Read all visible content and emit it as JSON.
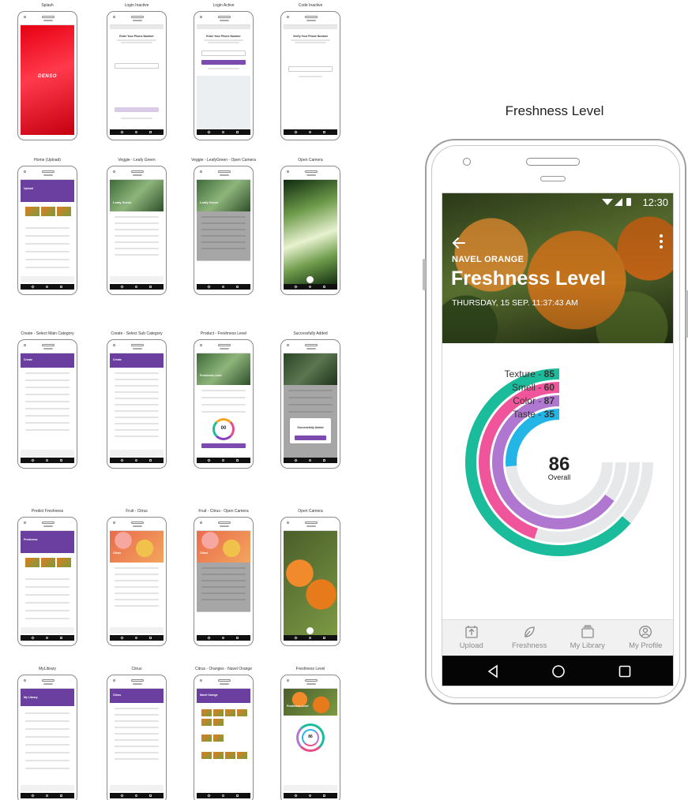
{
  "thumbnails": [
    {
      "caption": "Splash"
    },
    {
      "caption": "Login Inactive"
    },
    {
      "caption": "Login Active"
    },
    {
      "caption": "Code Inactive"
    },
    {
      "caption": "Home (Upload)"
    },
    {
      "caption": "Veggie - Leafy Green"
    },
    {
      "caption": "Veggie - LeafyGreen - Open Camera"
    },
    {
      "caption": "Open Camera"
    },
    {
      "caption": "Create - Select Main Category"
    },
    {
      "caption": "Create - Select Sub Category"
    },
    {
      "caption": "Product - Freshness Level"
    },
    {
      "caption": "Successfully Added"
    },
    {
      "caption": "Predict Freshness"
    },
    {
      "caption": "Fruit - Citrus"
    },
    {
      "caption": "Fruit - Citrus - Open Camera"
    },
    {
      "caption": "Open Camera"
    },
    {
      "caption": "MyLibrary"
    },
    {
      "caption": "Citrus"
    },
    {
      "caption": "Citrus - Oranges - Navel Orange"
    },
    {
      "caption": "Freshness Level"
    }
  ],
  "thumb_text": {
    "splash_logo": "DENSO",
    "enter_phone": "Enter Your Phone Number",
    "verify_phone": "Verify Your Phone Number",
    "upload": "Upload",
    "leafy_green": "Leafy Green",
    "create": "Create",
    "freshness_level": "Freshness Level",
    "successfully_added": "Successfully Added",
    "freshness": "Freshness",
    "citrus": "Citrus",
    "my_library": "My Library",
    "navel_orange": "Navel Orange",
    "score_placeholder": "00",
    "score_small": "86"
  },
  "section_title": "Freshness Level",
  "status": {
    "time": "12:30"
  },
  "header": {
    "subtitle": "NAVEL ORANGE",
    "title": "Freshness Level",
    "datetime": "THURSDAY, 15 SEP. 11:37:43 AM"
  },
  "chart_data": {
    "type": "radial-bar",
    "max": 100,
    "series": [
      {
        "name": "Texture",
        "value": 85,
        "color": "#1abc9c",
        "label": "Texture - 85"
      },
      {
        "name": "Smell",
        "value": 60,
        "color": "#f0559b",
        "label": "Smell - 60"
      },
      {
        "name": "Color",
        "value": 87,
        "color": "#b077d0",
        "label": "Color - 87"
      },
      {
        "name": "Taste",
        "value": 35,
        "color": "#22b5e6",
        "label": "Taste - 35"
      }
    ],
    "overall": {
      "value": 86,
      "label": "Overall"
    }
  },
  "tabs": [
    {
      "label": "Upload",
      "icon": "upload-icon"
    },
    {
      "label": "Freshness",
      "icon": "leaf-icon"
    },
    {
      "label": "My Library",
      "icon": "library-icon"
    },
    {
      "label": "My Profile",
      "icon": "profile-icon"
    }
  ]
}
